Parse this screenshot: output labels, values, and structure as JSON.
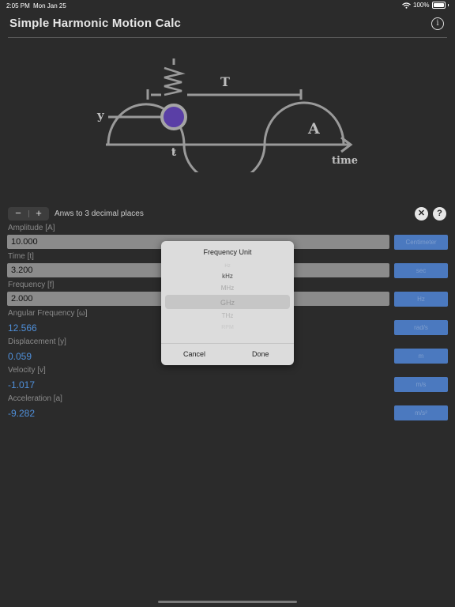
{
  "status": {
    "time": "2:05 PM",
    "date": "Mon Jan 25",
    "battery": "100%"
  },
  "app": {
    "title": "Simple Harmonic Motion Calc",
    "info_glyph": "i"
  },
  "diagram": {
    "label_T": "T",
    "label_y": "y",
    "label_A": "A",
    "label_t": "t",
    "label_time": "time"
  },
  "controls": {
    "minus": "−",
    "plus": "+",
    "precision": "Anws to 3 decimal places",
    "clear_glyph": "✕",
    "help_glyph": "?"
  },
  "fields": {
    "amplitude": {
      "label": "Amplitude [A]",
      "value": "10.000",
      "unit": "Centimeter"
    },
    "time": {
      "label": "Time [t]",
      "value": "3.200",
      "unit": "sec"
    },
    "frequency": {
      "label": "Frequency [f]",
      "value": "2.000",
      "unit": "Hz"
    }
  },
  "results": {
    "angular_frequency": {
      "label": "Angular Frequency [ω]",
      "value": "12.566",
      "unit": "rad/s"
    },
    "displacement": {
      "label": "Displacement [y]",
      "value": "0.059",
      "unit": "m"
    },
    "velocity": {
      "label": "Velocity [v]",
      "value": "-1.017",
      "unit": "m/s"
    },
    "acceleration": {
      "label": "Acceleration [a]",
      "value": "-9.282",
      "unit": "m/s²"
    }
  },
  "picker": {
    "title": "Frequency Unit",
    "options": [
      "Hz",
      "kHz",
      "MHz",
      "GHz",
      "THz",
      "RPM"
    ],
    "selected": "GHz",
    "cancel": "Cancel",
    "done": "Done"
  },
  "colors": {
    "background": "#2b2b2b",
    "accent_blue": "#4f8fd9",
    "unit_button": "#4b79bf",
    "mass": "#5a3fa6"
  }
}
